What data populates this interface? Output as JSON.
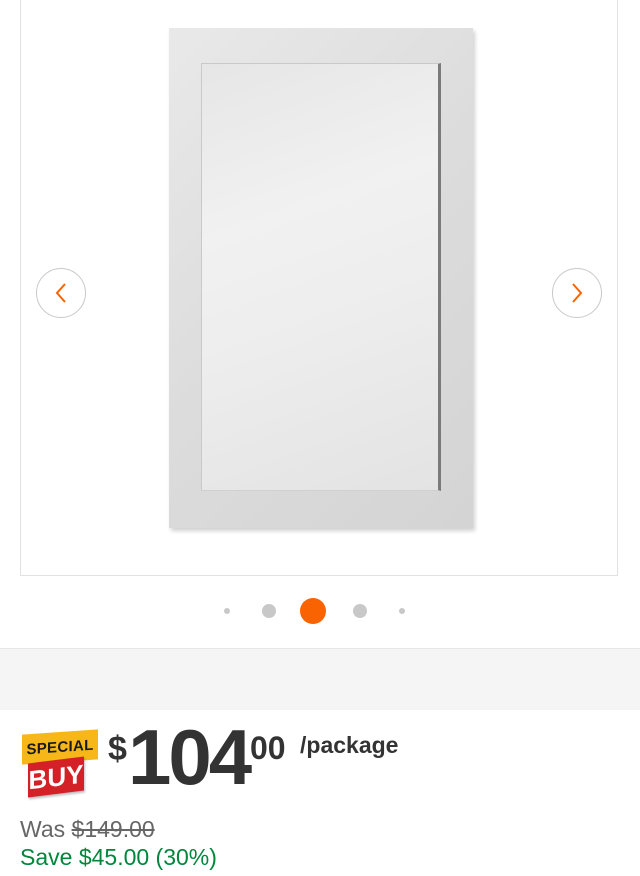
{
  "gallery": {
    "product_image": "bathroom-vanity-mirror-gray-frame",
    "prev_icon": "chevron-left-icon",
    "next_icon": "chevron-right-icon",
    "dot_count": 5,
    "active_dot_index": 2,
    "accent_color": "#f96302"
  },
  "badge": {
    "special_label": "SPECIAL",
    "buy_label": "BUY",
    "special_color": "#f7b718",
    "buy_color": "#d42027"
  },
  "price": {
    "currency_symbol": "$",
    "whole": "104",
    "cents": "00",
    "unit": "/package"
  },
  "was": {
    "label": "Was",
    "price": "$149.00"
  },
  "save": {
    "text": "Save $45.00 (30%)",
    "color": "#00873c"
  }
}
